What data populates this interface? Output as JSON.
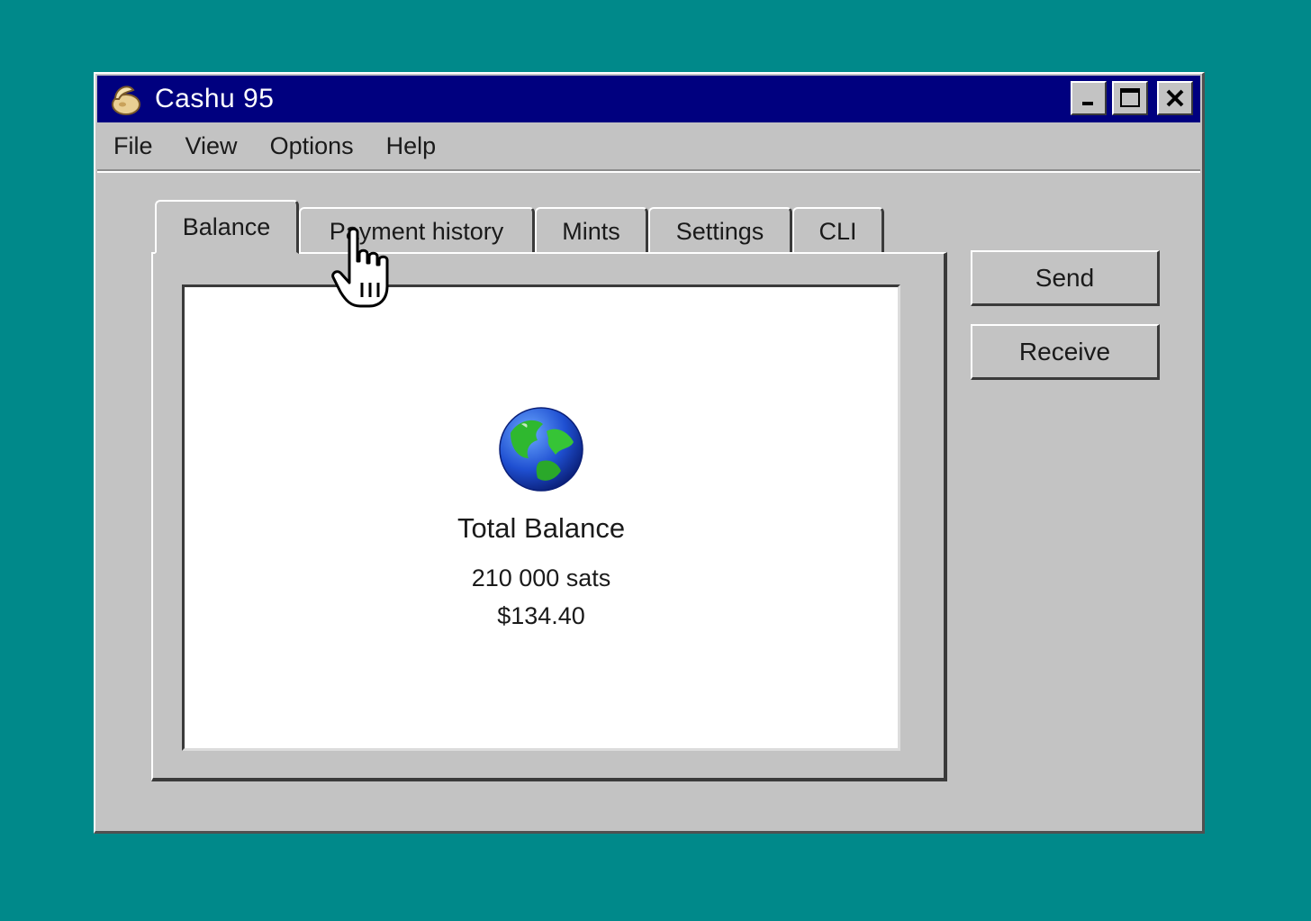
{
  "window": {
    "title": "Cashu 95",
    "app_icon": "cashu-nut-icon",
    "controls": {
      "minimize": "_",
      "maximize": "□",
      "close": "✕"
    }
  },
  "menu": [
    "File",
    "View",
    "Options",
    "Help"
  ],
  "tabs": [
    {
      "label": "Balance",
      "active": true
    },
    {
      "label": "Payment history",
      "active": false
    },
    {
      "label": "Mints",
      "active": false
    },
    {
      "label": "Settings",
      "active": false
    },
    {
      "label": "CLI",
      "active": false
    }
  ],
  "balance": {
    "icon": "globe-icon",
    "title": "Total Balance",
    "sats": "210 000 sats",
    "fiat": "$134.40"
  },
  "actions": {
    "send": "Send",
    "receive": "Receive"
  },
  "cursor": {
    "icon": "hand-pointer-icon"
  },
  "colors": {
    "desktop": "#00898a",
    "titlebar": "#00007f",
    "window_face": "#c3c3c3"
  }
}
